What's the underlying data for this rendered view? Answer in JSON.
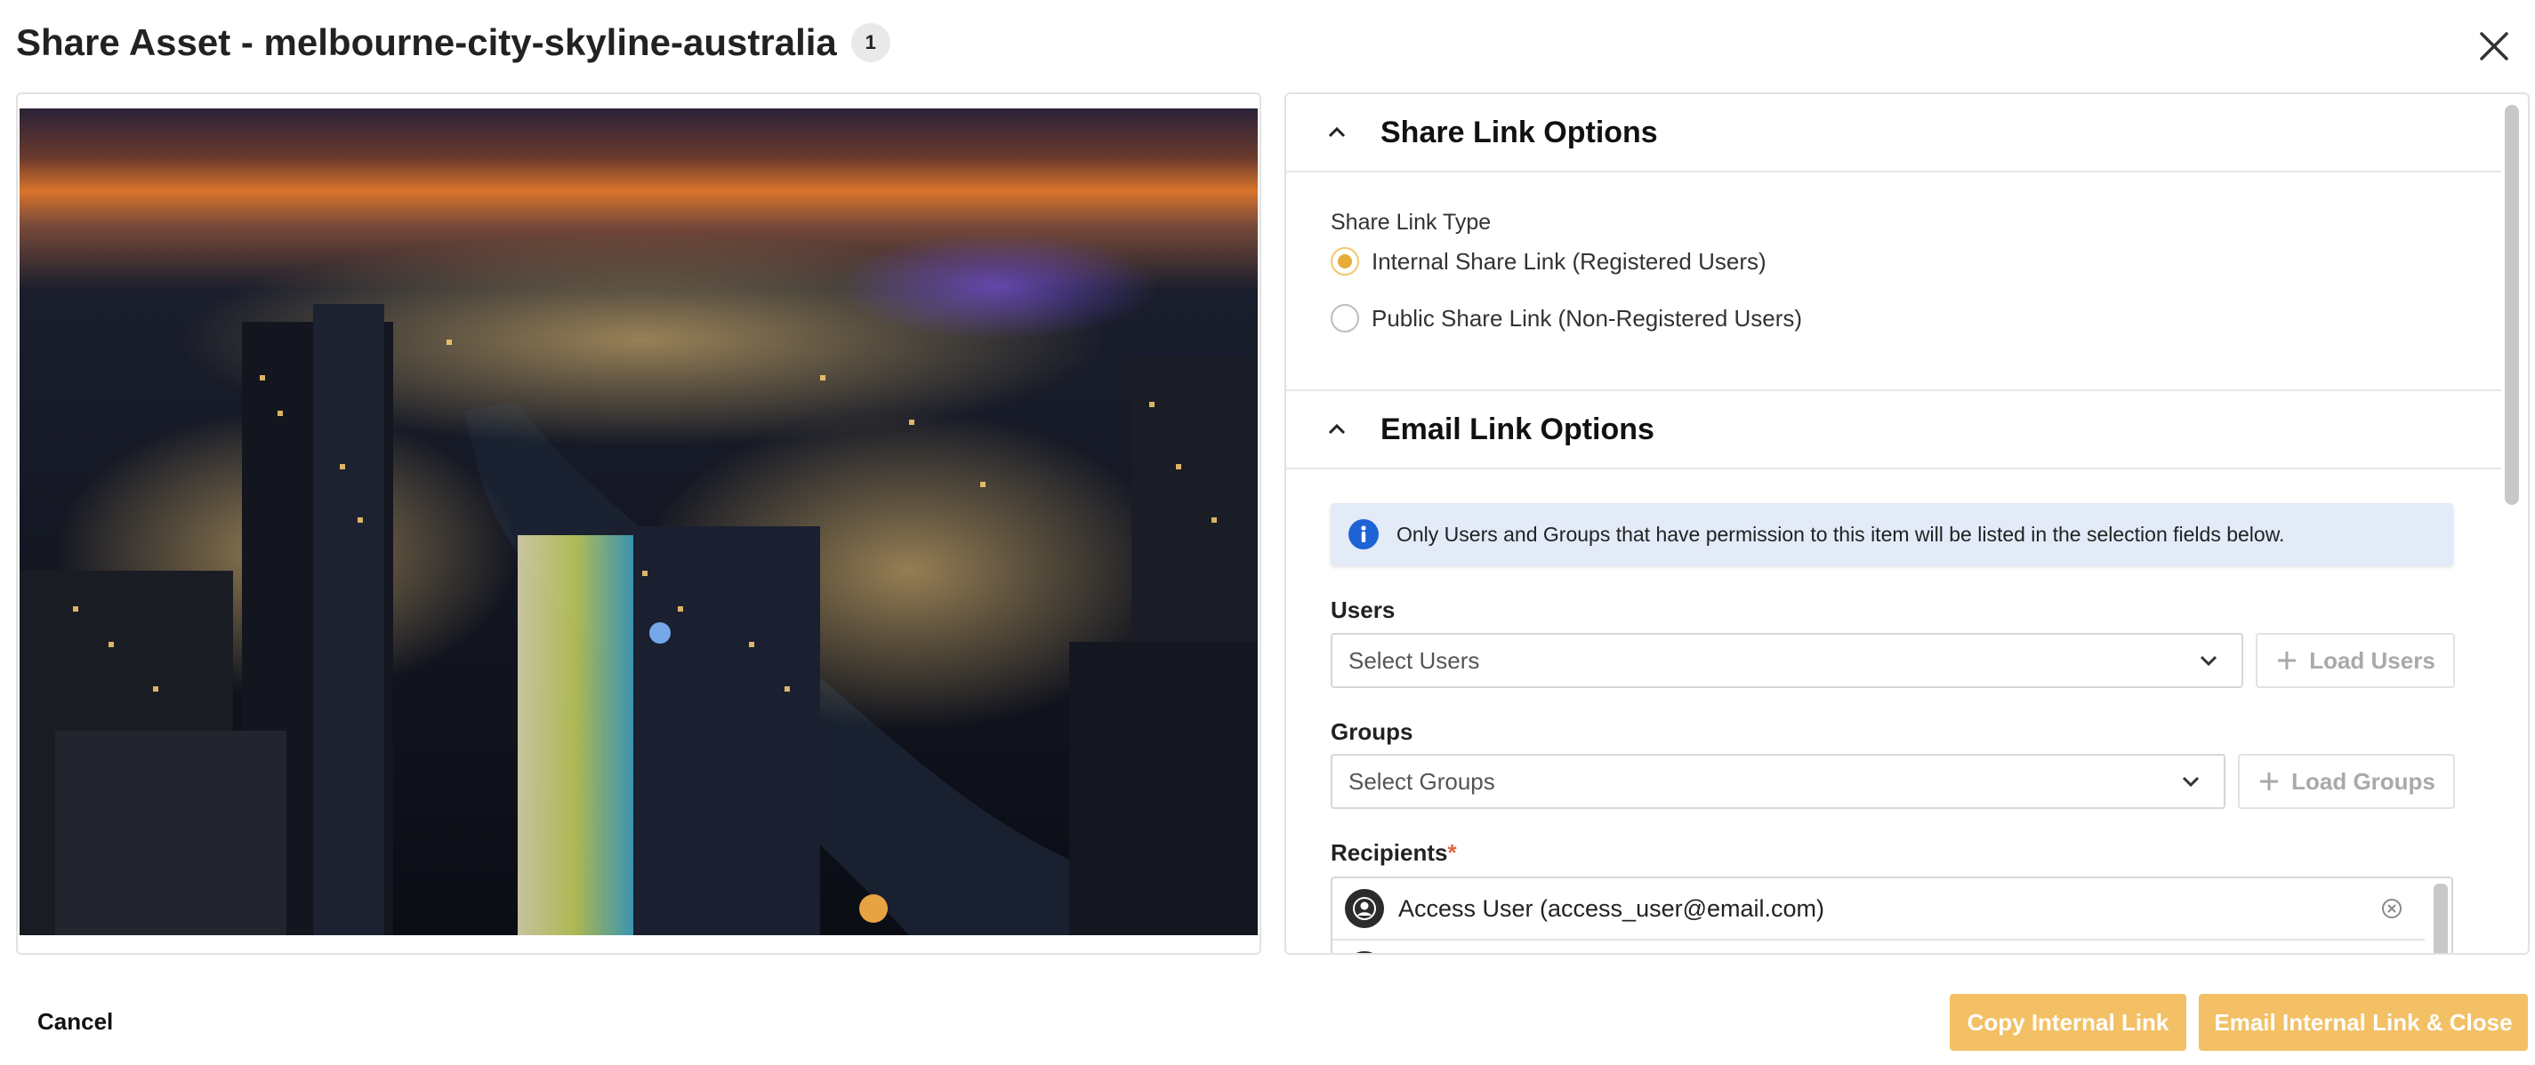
{
  "dialog": {
    "title": "Share Asset - melbourne-city-skyline-australia",
    "asset_count": "1"
  },
  "share_link_options": {
    "heading": "Share Link Options",
    "type_label": "Share Link Type",
    "options": [
      {
        "label": "Internal Share Link (Registered Users)",
        "selected": true
      },
      {
        "label": "Public Share Link (Non-Registered Users)",
        "selected": false
      }
    ]
  },
  "email_link_options": {
    "heading": "Email Link Options",
    "info_text": "Only Users and Groups that have permission to this item will be listed in the selection fields below.",
    "users": {
      "label": "Users",
      "placeholder": "Select Users",
      "load_button": "Load Users"
    },
    "groups": {
      "label": "Groups",
      "placeholder": "Select Groups",
      "load_button": "Load Groups"
    },
    "recipients": {
      "label": "Recipients",
      "required_mark": "*",
      "items": [
        {
          "name": "Access User (access_user@email.com)"
        }
      ]
    }
  },
  "footer": {
    "cancel": "Cancel",
    "copy_link": "Copy Internal Link",
    "email_link": "Email Internal Link & Close"
  },
  "colors": {
    "accent": "#f3c066",
    "radio_selected": "#e7ac38",
    "info_bg": "#e3eaf8",
    "info_icon": "#1e63d6",
    "required": "#e2643e"
  },
  "icons": {
    "close": "close-icon",
    "collapse": "chevron-up-icon",
    "dropdown": "chevron-down-icon",
    "add": "plus-icon",
    "info": "info-icon",
    "remove": "remove-circle-icon",
    "avatar": "user-avatar-icon"
  }
}
